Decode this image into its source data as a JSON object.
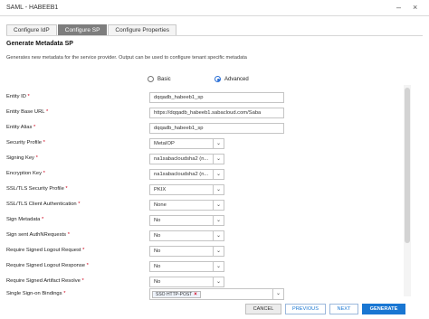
{
  "window": {
    "title": "SAML - HABEEB1"
  },
  "tabs": [
    {
      "label": "Configure IdP"
    },
    {
      "label": "Configure SP"
    },
    {
      "label": "Configure Properties"
    }
  ],
  "section": {
    "heading": "Generate Metadata SP",
    "description": "Generates new metadata for the service provider. Output can be used to configure tenant specific metadata"
  },
  "mode": {
    "basic_label": "Basic",
    "advanced_label": "Advanced",
    "selected": "Advanced"
  },
  "fields": {
    "entity_id": {
      "label": "Entity ID",
      "value": "dqqadb_habeeb1_sp"
    },
    "entity_base_url": {
      "label": "Entity Base URL",
      "value": "https://dqqadb_habeeb1.sabacloud.com/Saba"
    },
    "entity_alias": {
      "label": "Entity Alias",
      "value": "dqqadb_habeeb1_sp"
    },
    "security_profile": {
      "label": "Security Profile",
      "value": "MetaIOP"
    },
    "signing_key": {
      "label": "Signing Key",
      "value": "na1sabacloudsha2 (n..."
    },
    "encryption_key": {
      "label": "Encryption Key",
      "value": "na1sabacloudsha2 (n..."
    },
    "ssl_tls_security_profile": {
      "label": "SSL/TLS Security Profile",
      "value": "PKIX"
    },
    "ssl_tls_client_auth": {
      "label": "SSL/TLS Client Authentication",
      "value": "None"
    },
    "sign_metadata": {
      "label": "Sign Metadata",
      "value": "No"
    },
    "sign_sent_authn": {
      "label": "Sign sent AuthNRequests",
      "value": "No"
    },
    "require_signed_logout_request": {
      "label": "Require Signed Logout Request",
      "value": "No"
    },
    "require_signed_logout_response": {
      "label": "Require Signed Logout Response",
      "value": "No"
    },
    "require_signed_artifact_resolve": {
      "label": "Require Signed Artifact Resolve",
      "value": "No"
    },
    "sso_bindings": {
      "label": "Single Sign-on Bindings",
      "chip": "SSO HTTP-POST"
    }
  },
  "required_marker": "*",
  "footer": {
    "cancel": "CANCEL",
    "previous": "PREVIOUS",
    "next": "NEXT",
    "generate": "GENERATE"
  },
  "colors": {
    "primary": "#1976d2",
    "active_tab": "#7d7d7d",
    "required": "#d0021b"
  }
}
